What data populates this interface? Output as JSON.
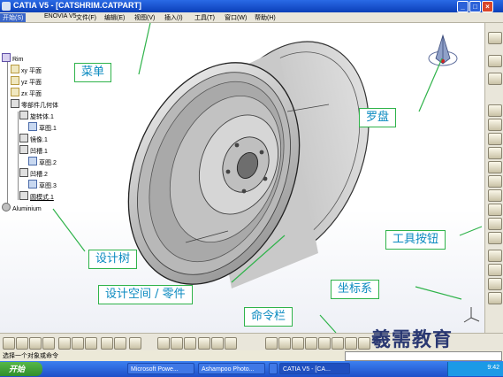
{
  "titlebar": {
    "title": "CATIA V5 - [CATSHRIM.CATPART]",
    "min": "_",
    "max": "□",
    "close": "×"
  },
  "menubar": {
    "items": [
      "开始(S)",
      "ENOVIA V5",
      "文件(F)",
      "编辑(E)",
      "视图(V)",
      "插入(I)",
      "工具(T)",
      "窗口(W)",
      "帮助(H)"
    ]
  },
  "tree": {
    "root": "Rim",
    "xy": "xy 平面",
    "yz": "yz 平面",
    "zx": "zx 平面",
    "body": "零部件几何体",
    "shaft": "旋转体.1",
    "sketch1": "草图.1",
    "mirror": "镜像.1",
    "groove1": "凹槽.1",
    "sketch2": "草图.2",
    "groove2": "凹槽.2",
    "sketch3": "草图.3",
    "pattern": "圆模式.1",
    "material": "Aluminium"
  },
  "callouts": {
    "menu": "菜单",
    "compass": "罗盘",
    "toolbuttons": "工具按钮",
    "designtree": "设计树",
    "workspace": "设计空间 / 零件",
    "axis": "坐标系",
    "cmdbar": "命令栏"
  },
  "statusbar": {
    "hint": "选择一个对象或命令"
  },
  "taskbar": {
    "start": "开始",
    "tasks": [
      "Microsoft Powe...",
      "Ashampoo Photo...",
      "",
      "CATIA V5 - [CA..."
    ],
    "time": "9:42"
  },
  "watermark": "羲需教育",
  "colors": {
    "accent": "#2fb34a",
    "callout_text": "#0b8ac0",
    "title_bg": "#0b3fb8"
  }
}
